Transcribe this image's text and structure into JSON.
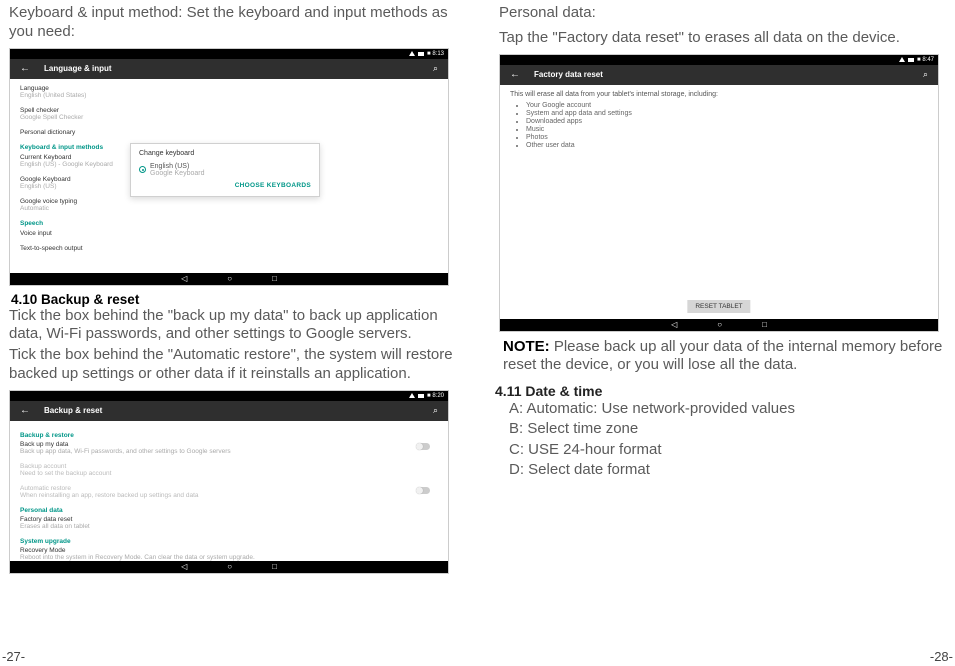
{
  "left": {
    "intro": "Keyboard & input method: Set the keyboard and input methods as you need:",
    "shot1": {
      "statusTime": "■ 8:13",
      "appbarTitle": "Language & input",
      "items": {
        "language": {
          "t": "Language",
          "s": "English (United States)"
        },
        "spell": {
          "t": "Spell checker",
          "s": "Google Spell Checker"
        },
        "dict": {
          "t": "Personal dictionary"
        },
        "headKbd": "Keyboard & input methods",
        "current": {
          "t": "Current Keyboard",
          "s": "English (US) - Google Keyboard"
        },
        "gkey": {
          "t": "Google Keyboard",
          "s": "English (US)"
        },
        "gvoice": {
          "t": "Google voice typing",
          "s": "Automatic"
        },
        "headSpeech": "Speech",
        "voice": {
          "t": "Voice input"
        },
        "tts": {
          "t": "Text-to-speech output"
        }
      },
      "modal": {
        "title": "Change keyboard",
        "optionMain": "English (US)",
        "optionSub": "Google Keyboard",
        "action": "CHOOSE KEYBOARDS"
      }
    },
    "secHead": "4.10 Backup & reset",
    "p1": "Tick the box behind the \"back up my data\" to back up application data, Wi-Fi passwords, and other settings to Google servers.",
    "p2": "Tick the box behind the \"Automatic restore\", the system will restore backed up settings or other data if it reinstalls an application.",
    "shot2": {
      "statusTime": "■ 8:20",
      "appbarTitle": "Backup & reset",
      "headBr": "Backup & restore",
      "backup": {
        "t": "Back up my data",
        "s": "Back up app data, Wi-Fi passwords, and other settings to Google servers"
      },
      "acct": {
        "t": "Backup account",
        "s": "Need to set the backup account"
      },
      "auto": {
        "t": "Automatic restore",
        "s": "When reinstalling an app, restore backed up settings and data"
      },
      "headPd": "Personal data",
      "fdr": {
        "t": "Factory data reset",
        "s": "Erases all data on tablet"
      },
      "headSu": "System upgrade",
      "rec": {
        "t": "Recovery Mode",
        "s": "Reboot into the system in Recovery Mode. Can clear the data or system upgrade."
      }
    }
  },
  "right": {
    "intro1": "Personal data:",
    "intro2": "Tap the \"Factory data reset\" to erases all data on the device.",
    "shot3": {
      "statusTime": "■ 8:47",
      "appbarTitle": "Factory data reset",
      "lead": "This will erase all data from your tablet's internal storage, including:",
      "bullets": [
        "Your Google account",
        "System and app data and settings",
        "Downloaded apps",
        "Music",
        "Photos",
        "Other user data"
      ],
      "button": "RESET TABLET"
    },
    "noteLabel": "NOTE:",
    "noteText": " Please back up all your data of the internal memory before reset the device, or you will lose all the data.",
    "secHead": "4.11 Date & time",
    "dt": {
      "a": "A: Automatic: Use network-provided values",
      "b": "B: Select time zone",
      "c": "C: USE 24-hour format",
      "d": "D: Select date format"
    }
  },
  "pageLeft": "-27-",
  "pageRight": "-28-"
}
